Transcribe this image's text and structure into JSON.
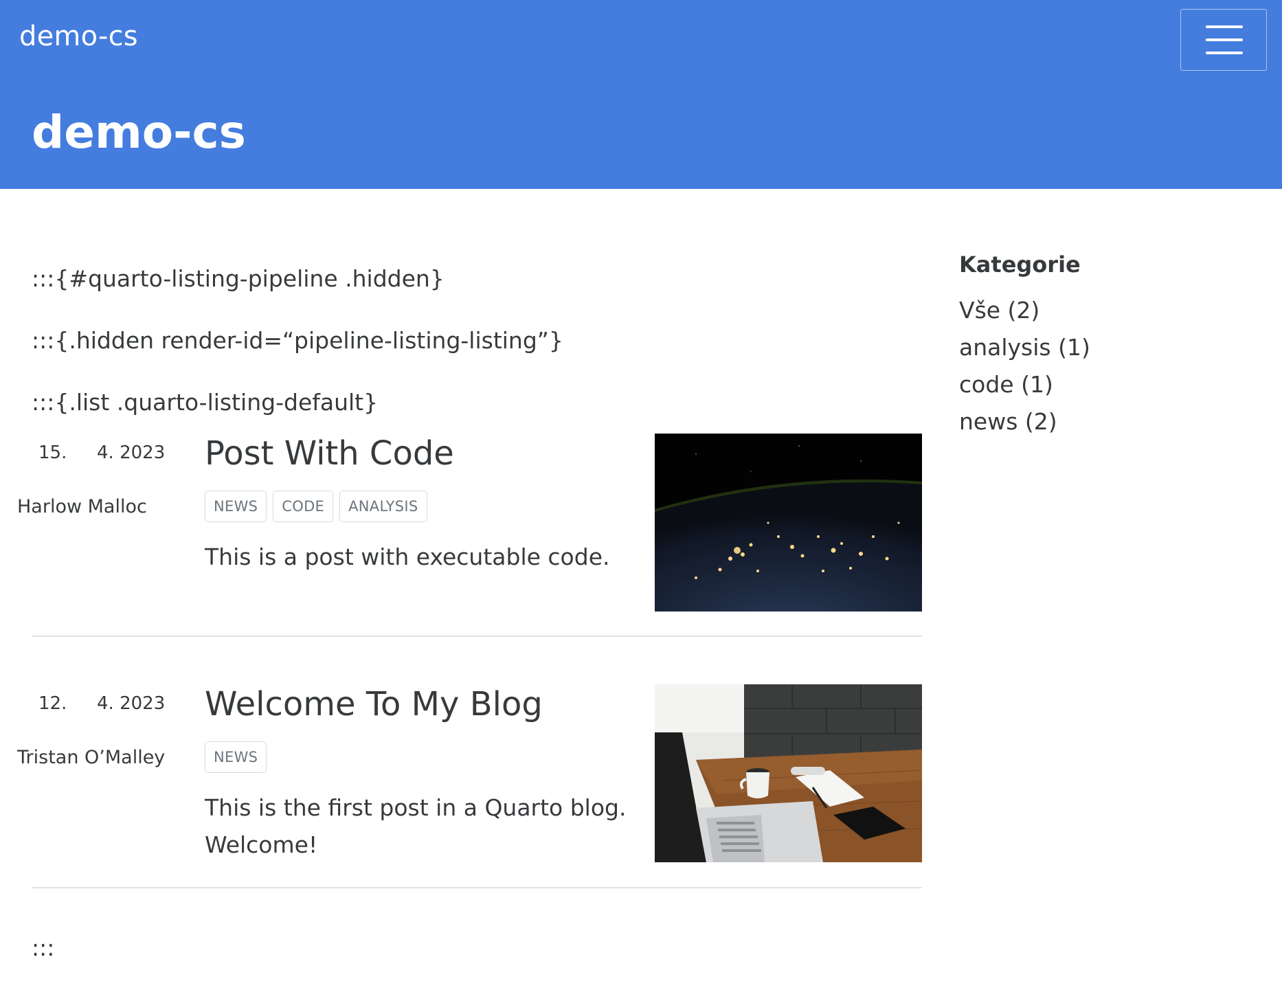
{
  "navbar": {
    "brand": "demo-cs"
  },
  "banner": {
    "title": "demo-cs"
  },
  "raw_lines": {
    "line1": ":::{#quarto-listing-pipeline .hidden}",
    "line2": ":::{.hidden render-id=“pipeline-listing-listing”}",
    "line3": ":::{.list .quarto-listing-default}",
    "closing": ":::"
  },
  "posts": [
    {
      "day": "15.",
      "month_year": "4. 2023",
      "author": "Harlow Malloc",
      "title": "Post With Code",
      "tags": [
        "news",
        "code",
        "analysis"
      ],
      "description": "This is a post with executable code.",
      "image": "night-earth-from-space"
    },
    {
      "day": "12.",
      "month_year": "4. 2023",
      "author": "Tristan O’Malley",
      "title": "Welcome To My Blog",
      "tags": [
        "news"
      ],
      "description": "This is the first post in a Quarto blog. Welcome!",
      "image": "laptop-coffee-desk"
    }
  ],
  "sidebar": {
    "heading": "Kategorie",
    "categories": [
      "Vše (2)",
      "analysis (1)",
      "code (1)",
      "news (2)"
    ]
  },
  "colors": {
    "header_bg": "#447dde",
    "text": "#373a3c",
    "tag_border": "#d9d9d9",
    "divider": "#dee2e6"
  }
}
